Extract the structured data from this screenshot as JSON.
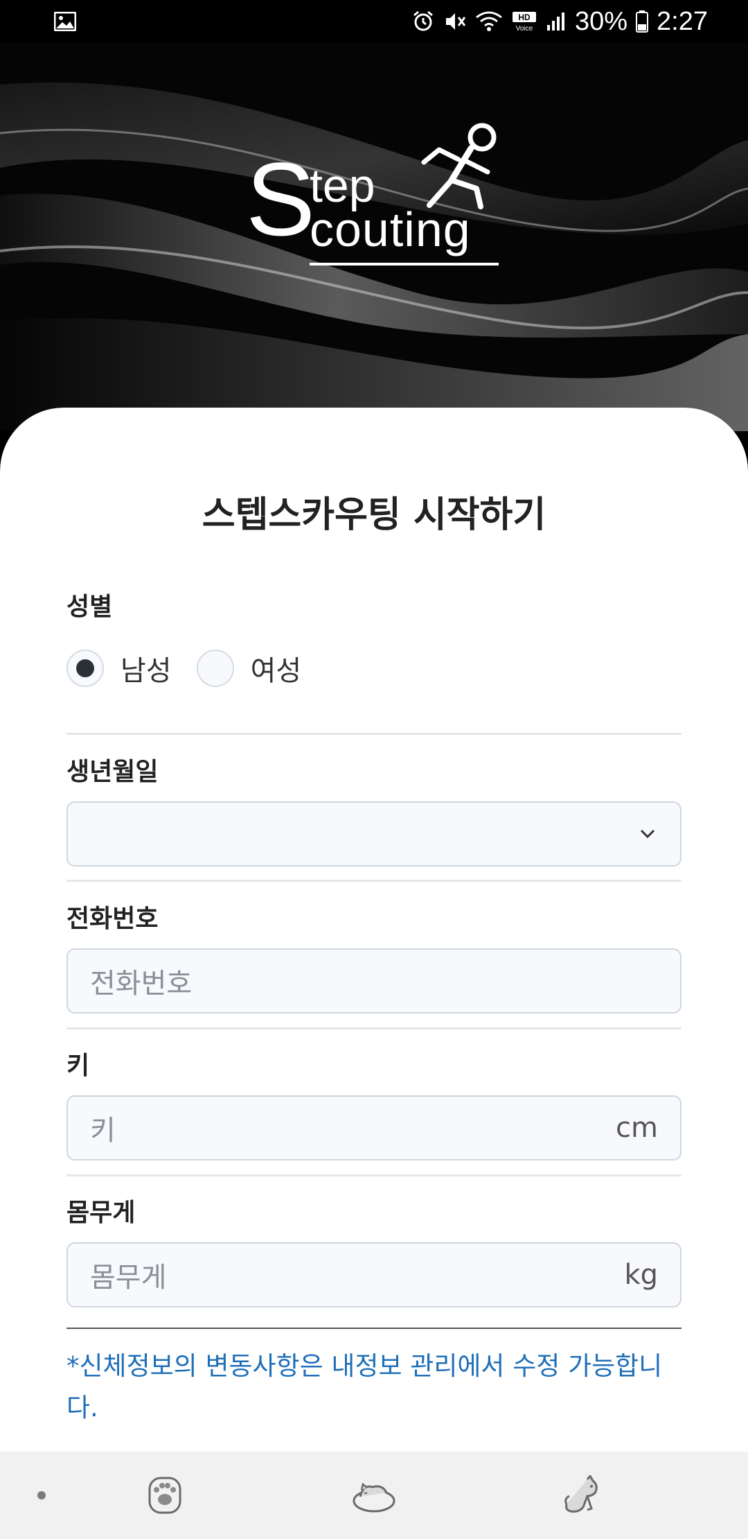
{
  "status_bar": {
    "battery_percent": "30%",
    "time": "2:27",
    "icons": [
      "gallery-icon",
      "alarm-icon",
      "mute-icon",
      "wifi-icon",
      "hd-voice-icon",
      "signal-icon",
      "battery-icon"
    ]
  },
  "hero": {
    "logo_big_letter": "S",
    "logo_line1": "tep",
    "logo_line2": "couting"
  },
  "form": {
    "title": "스텝스카우팅 시작하기",
    "gender": {
      "label": "성별",
      "options": [
        {
          "label": "남성",
          "selected": true
        },
        {
          "label": "여성",
          "selected": false
        }
      ]
    },
    "birthdate": {
      "label": "생년월일",
      "value": ""
    },
    "phone": {
      "label": "전화번호",
      "placeholder": "전화번호"
    },
    "height": {
      "label": "키",
      "placeholder": "키",
      "unit": "cm"
    },
    "weight": {
      "label": "몸무게",
      "placeholder": "몸무게",
      "unit": "kg"
    },
    "notice": "*신체정보의 변동사항은 내정보 관리에서 수정 가능합니다."
  },
  "bottom_nav": {
    "items": [
      "dot-icon",
      "paw-icon",
      "sleeping-cat-icon",
      "cat-icon"
    ]
  },
  "colors": {
    "accent_text": "#1f6fb8",
    "card_bg": "#ffffff",
    "field_bg": "#f7f9fc",
    "hero_bg": "#050505"
  }
}
